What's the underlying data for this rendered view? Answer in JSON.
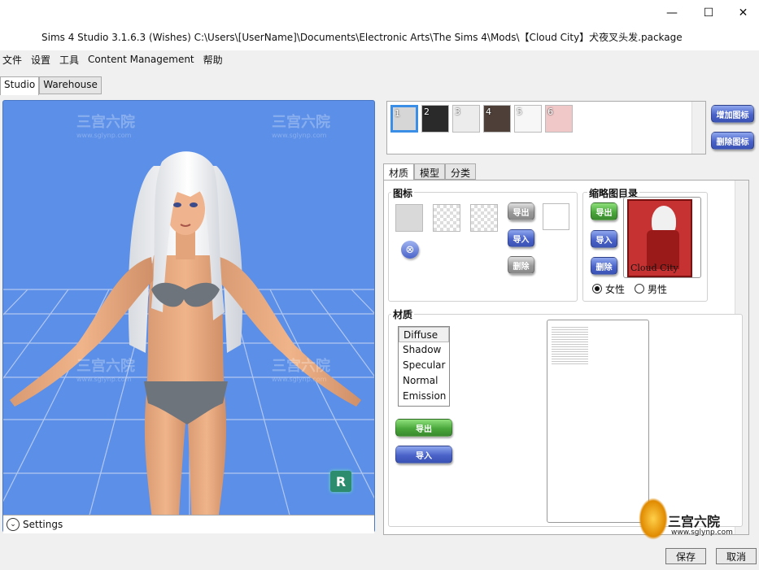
{
  "window": {
    "title": "Sims 4 Studio 3.1.6.3 (Wishes)  C:\\Users\\[UserName]\\Documents\\Electronic Arts\\The Sims 4\\Mods\\【Cloud City】犬夜叉头发.package",
    "minimize_glyph": "—",
    "maximize_glyph": "☐",
    "close_glyph": "✕"
  },
  "menu": [
    "文件",
    "设置",
    "工具",
    "Content Management",
    "帮助"
  ],
  "top_tabs": [
    "Studio",
    "Warehouse"
  ],
  "viewport": {
    "settings_label": "Settings",
    "rig_badge": "R",
    "colors": {
      "background": "#5b8fe8",
      "grid": "#c9d6f3"
    }
  },
  "swatches": [
    {
      "num": "1",
      "color": "#d6d6d6"
    },
    {
      "num": "2",
      "color": "#2a2a2a"
    },
    {
      "num": "3",
      "color": "#ececec"
    },
    {
      "num": "4",
      "color": "#4e4038"
    },
    {
      "num": "5",
      "color": "#f7f7f7"
    },
    {
      "num": "6",
      "color": "#f0c8c8"
    }
  ],
  "swatch_buttons": {
    "add": "增加图标",
    "remove": "删除图标"
  },
  "sub_tabs": [
    "材质",
    "模型",
    "分类"
  ],
  "icon_group": {
    "label": "图标",
    "export": "导出",
    "import": "导入",
    "delete": "删除"
  },
  "thumbnail_group": {
    "label": "缩略图目录",
    "export": "导出",
    "import": "导入",
    "delete": "删除",
    "thumb_text": "Cloud City",
    "female": "女性",
    "male": "男性"
  },
  "material_group": {
    "label": "材质",
    "items": [
      "Diffuse",
      "Shadow",
      "Specular",
      "Normal",
      "Emission"
    ],
    "export": "导出",
    "import": "导入"
  },
  "watermark": {
    "text": "三宫六院",
    "url": "www.sglynp.com"
  },
  "footer": {
    "save": "保存",
    "cancel": "取消"
  }
}
